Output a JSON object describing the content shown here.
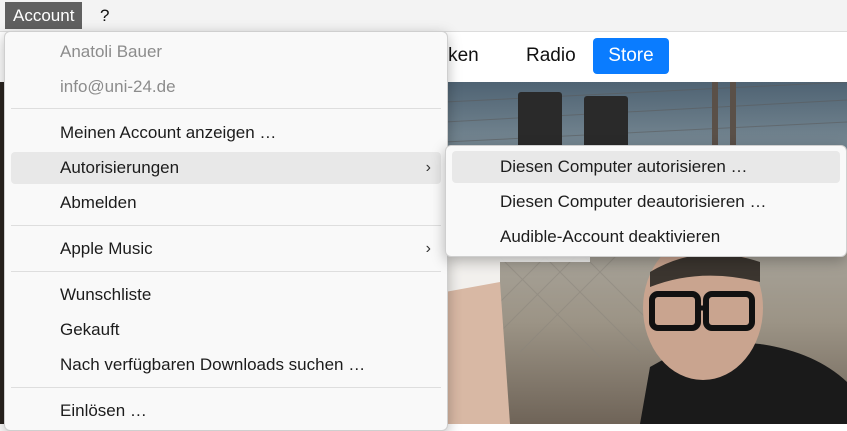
{
  "menubar": {
    "items": [
      {
        "label": "Account",
        "active": true
      },
      {
        "label": "?",
        "active": false
      }
    ]
  },
  "nav": {
    "entdecken_partial": "ecken",
    "radio": "Radio",
    "store": "Store",
    "store_color": "#0a7cff"
  },
  "account_menu": {
    "user_name": "Anatoli Bauer",
    "user_email": "info@uni-24.de",
    "items": {
      "show_account": "Meinen Account anzeigen …",
      "authorizations": "Autorisierungen",
      "sign_out": "Abmelden",
      "apple_music": "Apple Music",
      "wishlist": "Wunschliste",
      "purchased": "Gekauft",
      "check_downloads": "Nach verfügbaren Downloads suchen …",
      "redeem": "Einlösen …"
    },
    "submenu_chevron": "›"
  },
  "authorizations_submenu": {
    "items": [
      "Diesen Computer autorisieren …",
      "Diesen Computer deautorisieren …",
      "Audible-Account deaktivieren"
    ]
  }
}
